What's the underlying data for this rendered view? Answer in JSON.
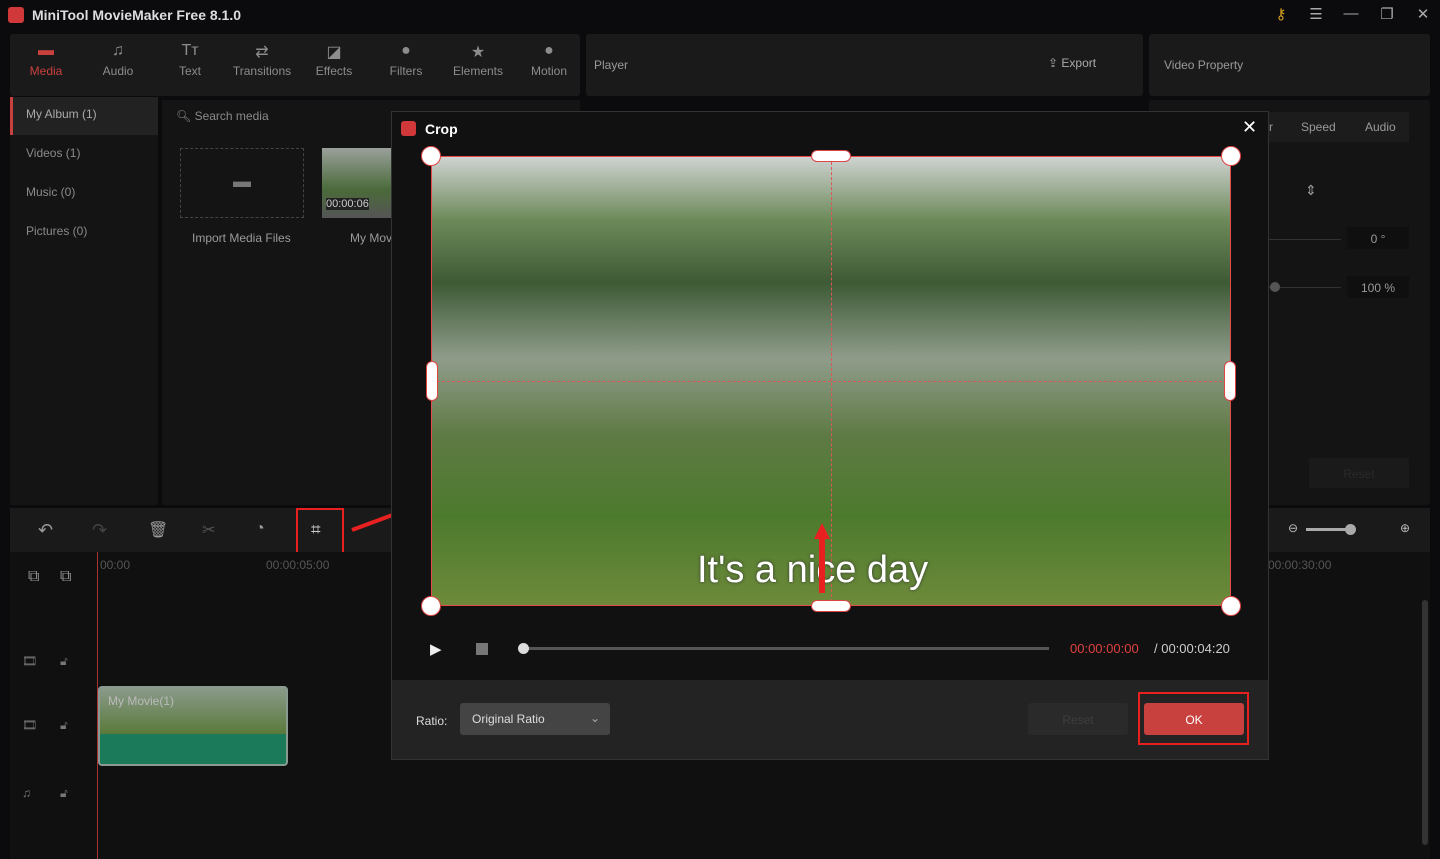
{
  "app": {
    "title": "MiniTool MovieMaker Free 8.1.0"
  },
  "toolbar": {
    "items": [
      {
        "label": "Media",
        "icon": "folder-icon"
      },
      {
        "label": "Audio",
        "icon": "music-icon"
      },
      {
        "label": "Text",
        "icon": "text-icon"
      },
      {
        "label": "Transitions",
        "icon": "transitions-icon"
      },
      {
        "label": "Effects",
        "icon": "effects-icon"
      },
      {
        "label": "Filters",
        "icon": "filters-icon"
      },
      {
        "label": "Elements",
        "icon": "elements-icon"
      },
      {
        "label": "Motion",
        "icon": "motion-icon"
      }
    ]
  },
  "player": {
    "title": "Player",
    "export": "Export"
  },
  "property": {
    "title": "Video Property",
    "tabs": [
      "r",
      "Speed",
      "Audio"
    ],
    "rotation": "0 °",
    "scale": "100 %",
    "reset": "Reset"
  },
  "sidebar": {
    "items": [
      "My Album (1)",
      "Videos (1)",
      "Music (0)",
      "Pictures (0)"
    ]
  },
  "media": {
    "search_placeholder": "Search media",
    "import_label": "Import Media Files",
    "clip_label": "My Movi",
    "clip_duration": "00:00:06"
  },
  "timeline": {
    "ticks": [
      "00:00",
      "00:00:05:00",
      "00:00:30:00"
    ],
    "clip": "My Movie(1)"
  },
  "crop": {
    "title": "Crop",
    "caption": "It's a nice day",
    "current_time": "00:00:00:00",
    "total_time": "/ 00:00:04:20",
    "ratio_label": "Ratio:",
    "ratio_value": "Original Ratio",
    "reset": "Reset",
    "ok": "OK"
  },
  "colors": {
    "accent": "#c8413f",
    "highlight": "#e82020"
  }
}
